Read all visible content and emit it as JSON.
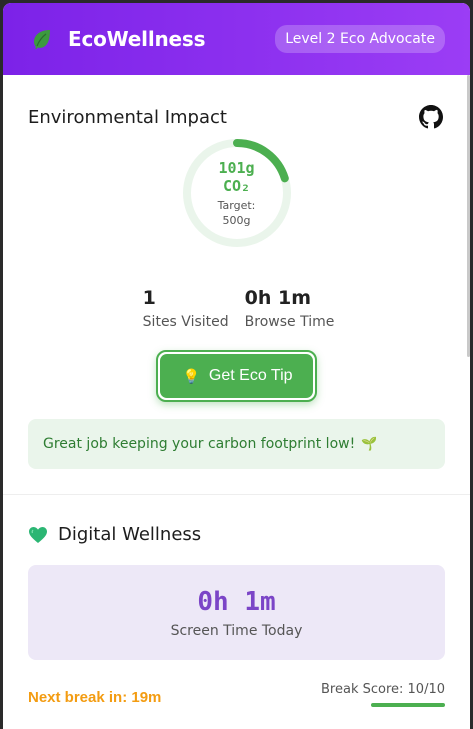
{
  "header": {
    "title": "EcoWellness",
    "level_badge": "Level 2 Eco Advocate",
    "brand_color": "#7c22e8"
  },
  "environmental": {
    "title": "Environmental Impact",
    "github_icon": "github-icon",
    "co2_value": "101g",
    "co2_unit": "CO₂",
    "target_label": "Target:",
    "target_value": "500g",
    "progress_fraction": 0.202,
    "accent": "#4caf50",
    "stats": [
      {
        "value": "1",
        "label": "Sites Visited"
      },
      {
        "value": "0h 1m",
        "label": "Browse Time"
      }
    ],
    "tip_button": "Get Eco Tip",
    "message": "Great job keeping your carbon footprint low!"
  },
  "wellness": {
    "title": "Digital Wellness",
    "screen_time": "0h 1m",
    "screen_time_label": "Screen Time Today",
    "next_break": "Next break in: 19m",
    "break_score": "Break Score: 10/10",
    "break_score_fraction": 1.0
  }
}
